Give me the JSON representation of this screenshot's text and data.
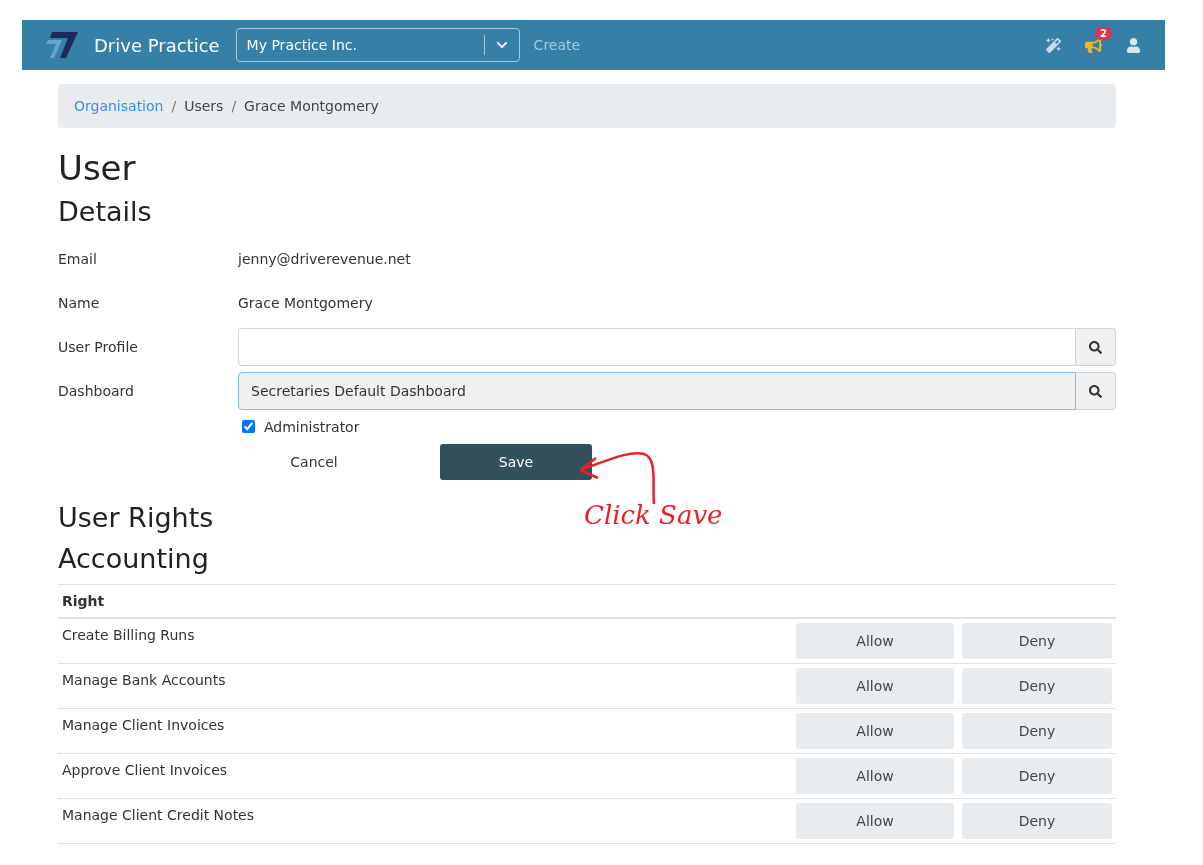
{
  "header": {
    "brand": "Drive Practice",
    "practice_select": {
      "value": "My Practice Inc."
    },
    "create_link": "Create",
    "notification_count": "2"
  },
  "breadcrumb": [
    {
      "label": "Organisation",
      "link": true
    },
    {
      "label": "Users",
      "link": false
    },
    {
      "label": "Grace Montgomery",
      "link": false
    }
  ],
  "breadcrumb_separator": "/",
  "page_title": "User",
  "details": {
    "title": "Details",
    "fields": [
      {
        "kind": "text",
        "label": "Email",
        "value": "jenny@driverevenue.net"
      },
      {
        "kind": "text",
        "label": "Name",
        "value": "Grace Montgomery"
      },
      {
        "kind": "lookup",
        "label": "User Profile",
        "focused": false
      },
      {
        "kind": "lookup",
        "label": "Dashboard",
        "value": "Secretaries Default Dashboard",
        "focused": true
      }
    ],
    "administrator": {
      "label": "Administrator",
      "checked": true
    },
    "cancel": "Cancel",
    "save": "Save"
  },
  "annotation": "Click Save",
  "rights": {
    "title": "User Rights",
    "section": "Accounting",
    "column": "Right",
    "rows": [
      {
        "name": "Create Billing Runs",
        "allow": "Allow",
        "deny": "Deny"
      },
      {
        "name": "Manage Bank Accounts",
        "allow": "Allow",
        "deny": "Deny"
      },
      {
        "name": "Manage Client Invoices",
        "allow": "Allow",
        "deny": "Deny"
      },
      {
        "name": "Approve Client Invoices",
        "allow": "Allow",
        "deny": "Deny"
      },
      {
        "name": "Manage Client Credit Notes",
        "allow": "Allow",
        "deny": "Deny"
      }
    ]
  }
}
